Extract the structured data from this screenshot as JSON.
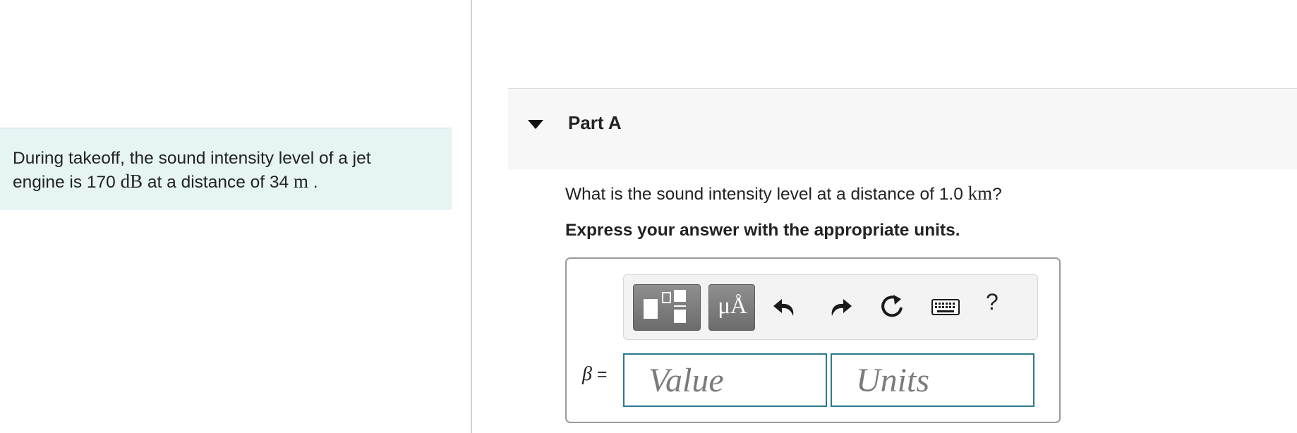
{
  "problem": {
    "line1": "During takeoff, the sound intensity level of a jet",
    "line2_prefix": "engine is 170 ",
    "line2_unit1": "dB",
    "line2_mid": " at a distance of 34 ",
    "line2_unit2": "m",
    "line2_suffix": " ."
  },
  "part": {
    "title": "Part A"
  },
  "question": {
    "prefix": "What is the sound intensity level at a distance of 1.0 ",
    "unit": "km",
    "suffix": "?"
  },
  "instruction": "Express your answer with the appropriate units.",
  "toolbar": {
    "units_glyph": "μÅ",
    "help": "?",
    "icons": [
      "templates-icon",
      "units-icon",
      "undo-icon",
      "redo-icon",
      "reset-icon",
      "keyboard-icon",
      "help-icon"
    ]
  },
  "answer": {
    "variable": "β",
    "equals": " =",
    "value_placeholder": "Value",
    "units_placeholder": "Units"
  },
  "colors": {
    "problem_bg": "#e6f4f4",
    "field_border": "#2a7a91",
    "header_bg": "#f7f7f7"
  }
}
